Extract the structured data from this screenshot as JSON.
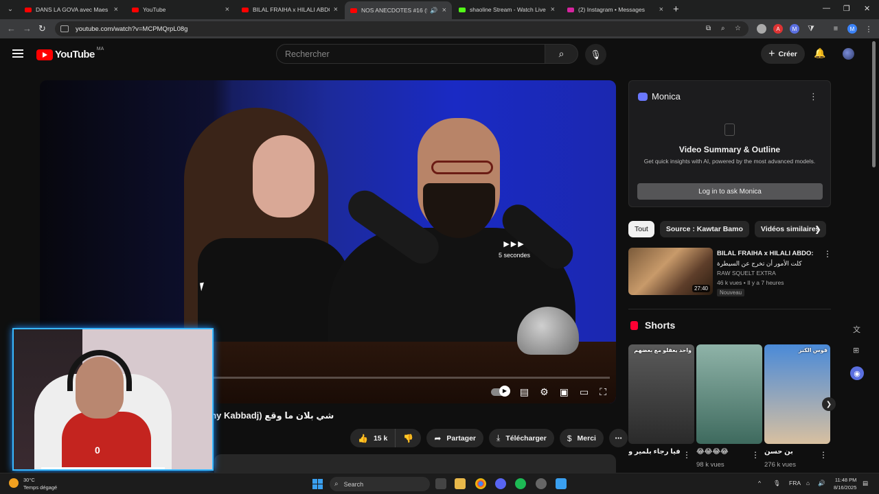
{
  "browser": {
    "tabs": [
      {
        "title": "DANS LA GOVA avec Maes | \"Le",
        "favicon_color": "#ff0000",
        "active": false
      },
      {
        "title": "YouTube",
        "favicon_color": "#ff0000",
        "active": false
      },
      {
        "title": "BILAL FRAIHA x HILALI ABDO:",
        "favicon_color": "#ff0000",
        "active": false
      },
      {
        "title": "NOS ANECDOTES #16 (ft Fa",
        "favicon_color": "#ff0000",
        "active": true
      },
      {
        "title": "shaoline Stream - Watch Live o",
        "favicon_color": "#53fc18",
        "active": false
      },
      {
        "title": "(2) Instagram • Messages",
        "favicon_color": "#d6249f",
        "active": false
      }
    ],
    "url": "youtube.com/watch?v=MCPMQrpL08g"
  },
  "youtube": {
    "logo_text": "YouTube",
    "country_code": "MA",
    "search_placeholder": "Rechercher",
    "create_label": "Créer",
    "brand_color": "#ff0000"
  },
  "player": {
    "skip_label": "5 secondes"
  },
  "video": {
    "title": "shy Kabbadj) شي بلان ما وقع",
    "likes": "15 k",
    "share_label": "Partager",
    "download_label": "Télécharger",
    "thanks_label": "Merci"
  },
  "webcam": {
    "jersey_number": "0"
  },
  "monica": {
    "name": "Monica",
    "heading": "Video Summary & Outline",
    "subtitle": "Get quick insights with AI, powered by the most advanced models.",
    "login_label": "Log in to ask Monica"
  },
  "chips": [
    "Tout",
    "Source : Kawtar Bamo",
    "Vidéos similaires"
  ],
  "recommended": {
    "title_line1": "BILAL FRAIHA x HILALI ABDO:",
    "title_line2": "كلت الأمور أن تخرج عن السيطرة",
    "channel": "RAW SQUELT EXTRA",
    "meta": "46 k vues • Il y a 7 heures",
    "badge": "Nouveau",
    "duration": "27:40"
  },
  "shorts": {
    "heading": "Shorts",
    "items": [
      {
        "title": "كواليس برنامج فيا رجاء بلمير و...",
        "views": "",
        "caption": "واحد يعقلو مع بعضهم",
        "color1": "#5a5a5a",
        "color2": "#2a2a2a"
      },
      {
        "title": "😂😂😂😂",
        "views": "98 k vues",
        "caption": "",
        "color1": "#8fb3a8",
        "color2": "#3e6a5e"
      },
      {
        "title": "بن حسن",
        "views": "276 k vues",
        "caption": "قوس الكنز",
        "color1": "#4a8ad8",
        "color2": "#d8c0a0"
      }
    ]
  },
  "taskbar": {
    "temperature": "30°C",
    "weather": "Temps dégagé",
    "search_label": "Search",
    "language": "FRA",
    "time": "11:48 PM",
    "date": "8/16/2025"
  }
}
